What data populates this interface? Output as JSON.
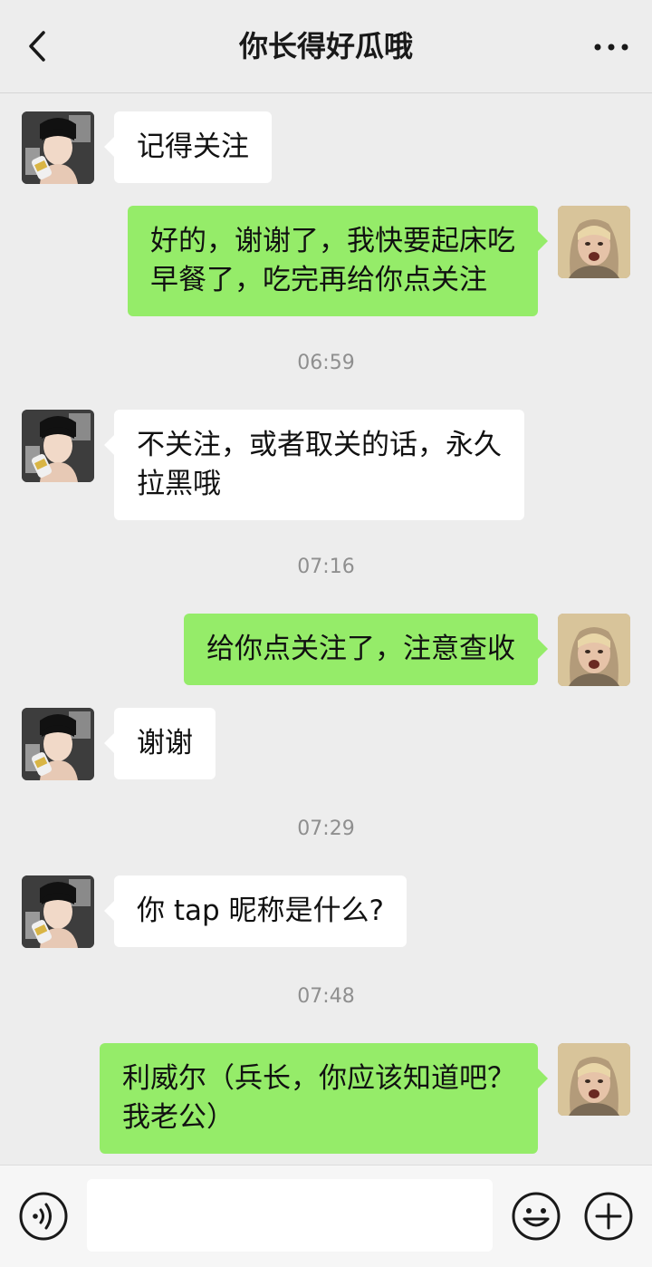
{
  "header": {
    "title": "你长得好瓜哦"
  },
  "icons": {
    "back": "chevron-left-icon",
    "more": "more-icon",
    "voice": "voice-icon",
    "emoji": "emoji-icon",
    "plus": "plus-icon"
  },
  "colors": {
    "sent_bubble": "#95ec69",
    "received_bubble": "#ffffff",
    "background": "#ededed"
  },
  "messages": [
    {
      "side": "left",
      "lines": [
        "记得关注"
      ]
    },
    {
      "side": "right",
      "lines": [
        "好的，谢谢了，我快要起床吃",
        "早餐了，吃完再给你点关注"
      ]
    },
    {
      "time": "06:59"
    },
    {
      "side": "left",
      "lines": [
        "不关注，或者取关的话，永久",
        "拉黑哦"
      ]
    },
    {
      "time": "07:16"
    },
    {
      "side": "right",
      "lines": [
        "给你点关注了，注意查收"
      ]
    },
    {
      "side": "left",
      "lines": [
        "谢谢"
      ]
    },
    {
      "time": "07:29"
    },
    {
      "side": "left",
      "lines": [
        "你 tap 昵称是什么?"
      ]
    },
    {
      "time": "07:48"
    },
    {
      "side": "right",
      "lines": [
        "利威尔（兵长，你应该知道吧？",
        "我老公）"
      ]
    }
  ],
  "input": {
    "value": ""
  }
}
